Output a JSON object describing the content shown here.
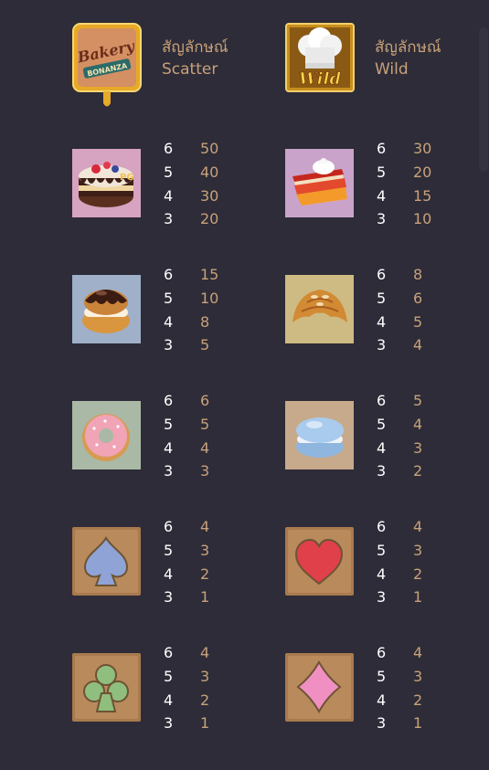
{
  "special": [
    {
      "icon": "bakery-bonanza-scatter-icon",
      "title_th": "สัญลักษณ์",
      "title_en": "Scatter"
    },
    {
      "icon": "wild-chef-hat-icon",
      "title_th": "สัญลักษณ์",
      "title_en": "Wild"
    }
  ],
  "symbols": [
    {
      "icon": "layer-cake-icon",
      "rows": [
        {
          "count": "6",
          "pay": "50"
        },
        {
          "count": "5",
          "pay": "40"
        },
        {
          "count": "4",
          "pay": "30"
        },
        {
          "count": "3",
          "pay": "20"
        }
      ]
    },
    {
      "icon": "pie-slice-icon",
      "rows": [
        {
          "count": "6",
          "pay": "30"
        },
        {
          "count": "5",
          "pay": "20"
        },
        {
          "count": "4",
          "pay": "15"
        },
        {
          "count": "3",
          "pay": "10"
        }
      ]
    },
    {
      "icon": "cream-puff-icon",
      "rows": [
        {
          "count": "6",
          "pay": "15"
        },
        {
          "count": "5",
          "pay": "10"
        },
        {
          "count": "4",
          "pay": "8"
        },
        {
          "count": "3",
          "pay": "5"
        }
      ]
    },
    {
      "icon": "croissant-icon",
      "rows": [
        {
          "count": "6",
          "pay": "8"
        },
        {
          "count": "5",
          "pay": "6"
        },
        {
          "count": "4",
          "pay": "5"
        },
        {
          "count": "3",
          "pay": "4"
        }
      ]
    },
    {
      "icon": "donut-icon",
      "rows": [
        {
          "count": "6",
          "pay": "6"
        },
        {
          "count": "5",
          "pay": "5"
        },
        {
          "count": "4",
          "pay": "4"
        },
        {
          "count": "3",
          "pay": "3"
        }
      ]
    },
    {
      "icon": "macaron-icon",
      "rows": [
        {
          "count": "6",
          "pay": "5"
        },
        {
          "count": "5",
          "pay": "4"
        },
        {
          "count": "4",
          "pay": "3"
        },
        {
          "count": "3",
          "pay": "2"
        }
      ]
    },
    {
      "icon": "spade-icon",
      "rows": [
        {
          "count": "6",
          "pay": "4"
        },
        {
          "count": "5",
          "pay": "3"
        },
        {
          "count": "4",
          "pay": "2"
        },
        {
          "count": "3",
          "pay": "1"
        }
      ]
    },
    {
      "icon": "heart-icon",
      "rows": [
        {
          "count": "6",
          "pay": "4"
        },
        {
          "count": "5",
          "pay": "3"
        },
        {
          "count": "4",
          "pay": "2"
        },
        {
          "count": "3",
          "pay": "1"
        }
      ]
    },
    {
      "icon": "club-icon",
      "rows": [
        {
          "count": "6",
          "pay": "4"
        },
        {
          "count": "5",
          "pay": "3"
        },
        {
          "count": "4",
          "pay": "2"
        },
        {
          "count": "3",
          "pay": "1"
        }
      ]
    },
    {
      "icon": "diamond-icon",
      "rows": [
        {
          "count": "6",
          "pay": "4"
        },
        {
          "count": "5",
          "pay": "3"
        },
        {
          "count": "4",
          "pay": "2"
        },
        {
          "count": "3",
          "pay": "1"
        }
      ]
    }
  ],
  "colors": {
    "background": "#2d2c38",
    "count": "#ffffff",
    "payout": "#c9a17a",
    "label": "#c9a17a"
  }
}
